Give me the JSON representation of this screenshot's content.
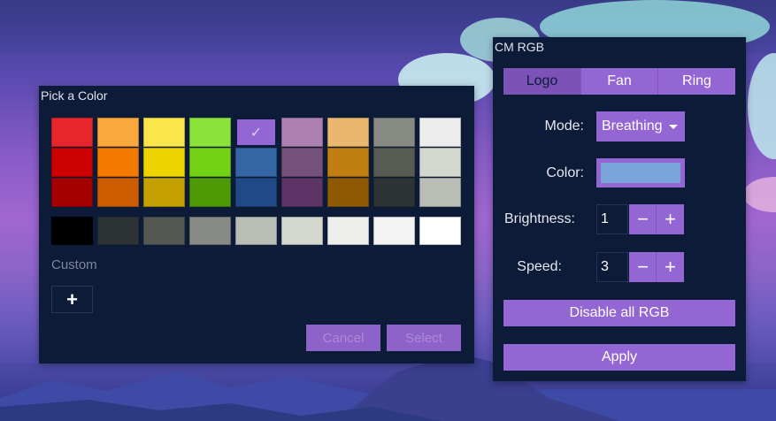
{
  "picker": {
    "title": "Pick a Color",
    "palette": [
      [
        "#e7262c",
        "#f8a83c",
        "#fbe54c",
        "#8ae23a",
        "#9466d4",
        "#ac80b0",
        "#e9b76e",
        "#868a82",
        "#ececec"
      ],
      [
        "#cc0000",
        "#f47900",
        "#edd400",
        "#73d216",
        "#3466a5",
        "#76517b",
        "#c17e11",
        "#565c54",
        "#d3d7cf"
      ],
      [
        "#a40000",
        "#cd5c00",
        "#c4a000",
        "#4e9a06",
        "#204a87",
        "#5c3566",
        "#8f5902",
        "#2e3436",
        "#babdb6"
      ]
    ],
    "selected_swatch": {
      "row": 0,
      "col": 4,
      "icon": "check-icon",
      "glyph": "✓"
    },
    "grays": [
      "#000000",
      "#2e3436",
      "#555753",
      "#888a85",
      "#babdb6",
      "#d3d7cf",
      "#eeeeec",
      "#f3f3f3",
      "#ffffff"
    ],
    "custom_label": "Custom",
    "add_glyph": "+",
    "cancel_label": "Cancel",
    "select_label": "Select"
  },
  "cmrgb": {
    "title": "CM RGB",
    "tabs": [
      {
        "label": "Logo",
        "active": true
      },
      {
        "label": "Fan",
        "active": false
      },
      {
        "label": "Ring",
        "active": false
      }
    ],
    "mode_label": "Mode:",
    "mode_value": "Breathing",
    "color_label": "Color:",
    "color_value": "#78a4d8",
    "brightness_label": "Brightness:",
    "brightness_value": "1",
    "speed_label": "Speed:",
    "speed_value": "3",
    "minus_glyph": "−",
    "plus_glyph": "+",
    "disable_label": "Disable all RGB",
    "apply_label": "Apply"
  }
}
